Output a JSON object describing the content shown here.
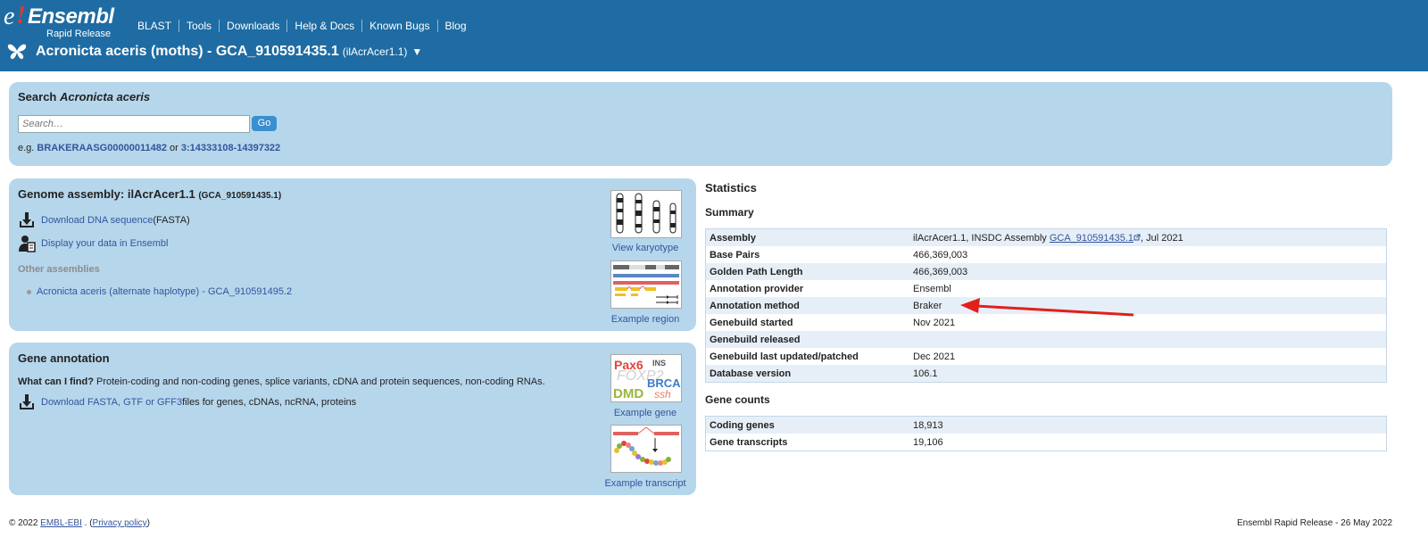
{
  "brand": {
    "logo_e": "e",
    "logo_bang": "!",
    "logo_name": "Ensembl",
    "logo_sub": "Rapid Release"
  },
  "nav": [
    "BLAST",
    "Tools",
    "Downloads",
    "Help & Docs",
    "Known Bugs",
    "Blog"
  ],
  "species": {
    "name": "Acronicta aceris (moths) - GCA_910591435.1",
    "assembly": "(ilAcrAcer1.1)",
    "dropdown": "▼",
    "icon": "butterfly-icon"
  },
  "search": {
    "title_prefix": "Search ",
    "title_species": "Acronicta aceris",
    "placeholder": "Search…",
    "go": "Go",
    "eg_prefix": "e.g. ",
    "eg_link1": "BRAKERAASG00000011482",
    "eg_or": " or ",
    "eg_link2": "3:14333108-14397322"
  },
  "assembly_panel": {
    "title": "Genome assembly: ilAcrAcer1.1",
    "title_small": "(GCA_910591435.1)",
    "download_link": "Download DNA sequence",
    "download_suffix": " (FASTA)",
    "display_link": "Display your data in Ensembl",
    "other_heading": "Other assemblies",
    "other_item": "Acronicta aceris (alternate haplotype) - GCA_910591495.2",
    "thumb1_label": "View karyotype",
    "thumb2_label": "Example region"
  },
  "gene_panel": {
    "title": "Gene annotation",
    "wcf_label": "What can I find?",
    "wcf_text": " Protein-coding and non-coding genes, splice variants, cDNA and protein sequences, non-coding RNAs.",
    "download_link": "Download FASTA, GTF or GFF3",
    "download_suffix": " files for genes, cDNAs, ncRNA, proteins",
    "thumb1_label": "Example gene",
    "thumb2_label": "Example transcript",
    "thumb1_words": [
      "Pax6",
      "INS",
      "FOXP2",
      "BRCA2",
      "DMD",
      "ssh"
    ]
  },
  "statistics": {
    "title": "Statistics",
    "summary_title": "Summary",
    "summary": [
      {
        "k": "Assembly",
        "v": "ilAcrAcer1.1, INSDC Assembly ",
        "link": "GCA_910591435.1",
        "after": ", Jul 2021"
      },
      {
        "k": "Base Pairs",
        "v": "466,369,003"
      },
      {
        "k": "Golden Path Length",
        "v": "466,369,003"
      },
      {
        "k": "Annotation provider",
        "v": "Ensembl"
      },
      {
        "k": "Annotation method",
        "v": "Braker"
      },
      {
        "k": "Genebuild started",
        "v": "Nov 2021"
      },
      {
        "k": "Genebuild released",
        "v": ""
      },
      {
        "k": "Genebuild last updated/patched",
        "v": "Dec 2021"
      },
      {
        "k": "Database version",
        "v": "106.1"
      }
    ],
    "counts_title": "Gene counts",
    "counts": [
      {
        "k": "Coding genes",
        "v": "18,913"
      },
      {
        "k": "Gene transcripts",
        "v": "19,106"
      }
    ]
  },
  "footer": {
    "copyright": "© 2022 ",
    "ebi": "EMBL-EBI",
    "mid": " . (",
    "privacy": "Privacy policy",
    "end": ")",
    "release": "Ensembl Rapid Release - 26 May 2022"
  },
  "colors": {
    "header": "#1e6ca3",
    "panel": "#b6d6ec",
    "link": "#33559b",
    "arrow": "#e0201b"
  }
}
